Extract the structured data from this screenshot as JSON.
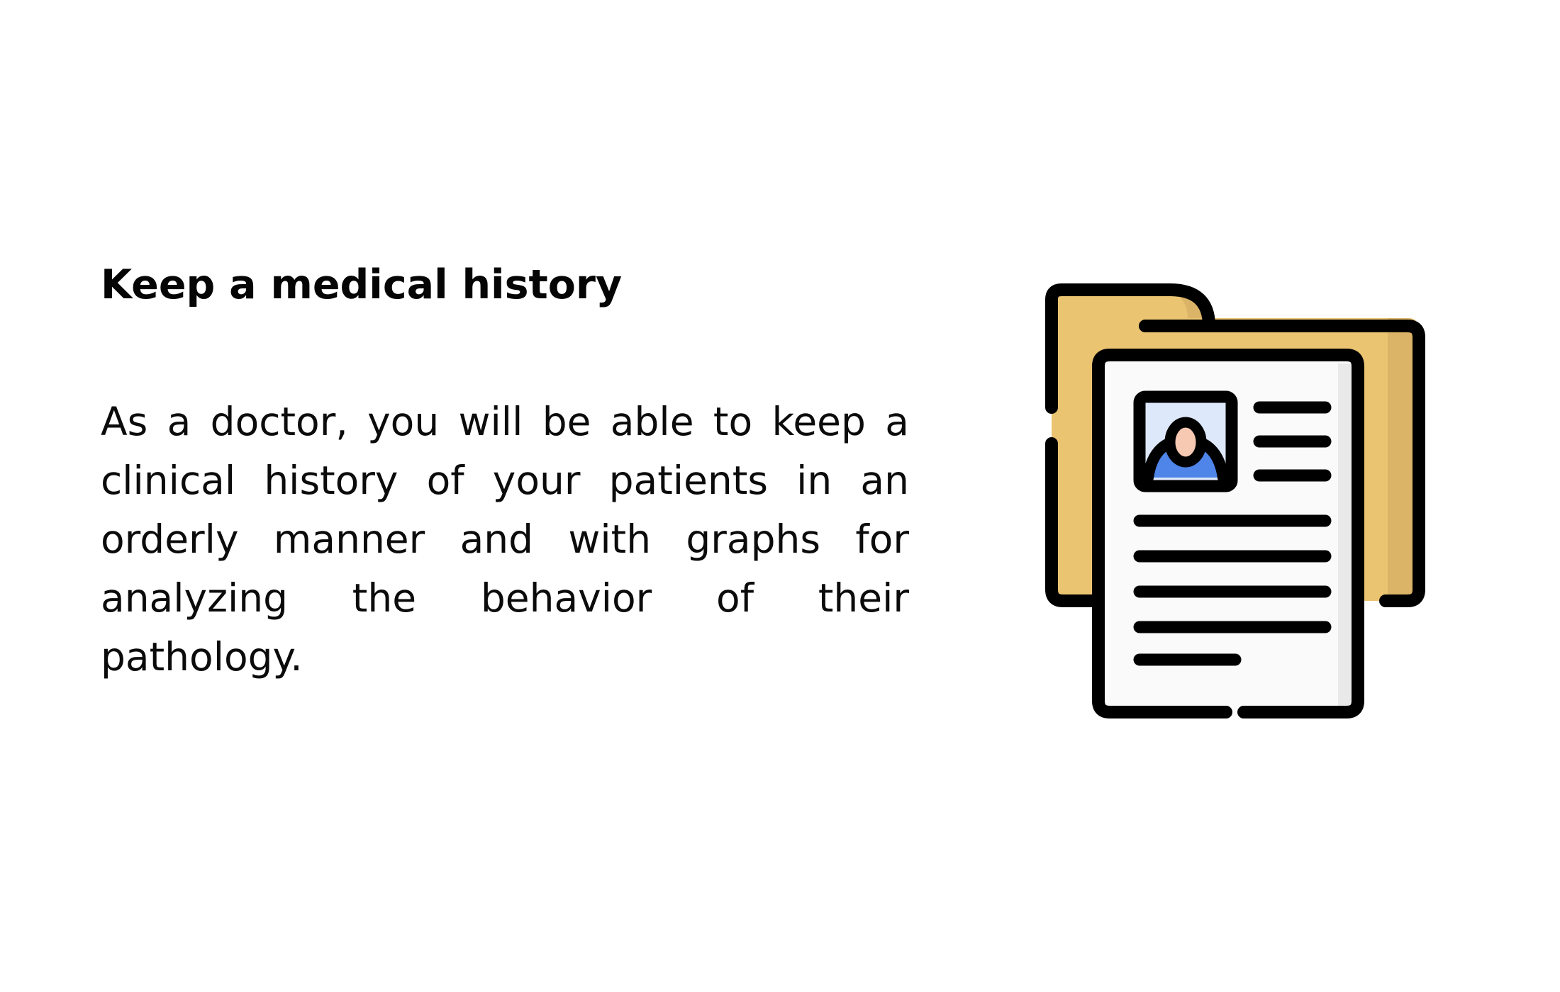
{
  "feature": {
    "title": "Keep a medical history",
    "description": "As a doctor, you will be able to keep a clinical history of your patients in an orderly manner and with graphs for analyzing the behavior of their pathology."
  },
  "illustration": {
    "icon": "medical-record-folder-icon",
    "colors": {
      "outline": "#000000",
      "folder": "#EBC471",
      "folder_shade": "#DCB467",
      "paper": "#FAFAFA",
      "paper_shade": "#E9E9E9",
      "photo_background": "#DDE8FA",
      "avatar_body": "#4F84E8",
      "avatar_skin": "#F8C9B2"
    }
  }
}
